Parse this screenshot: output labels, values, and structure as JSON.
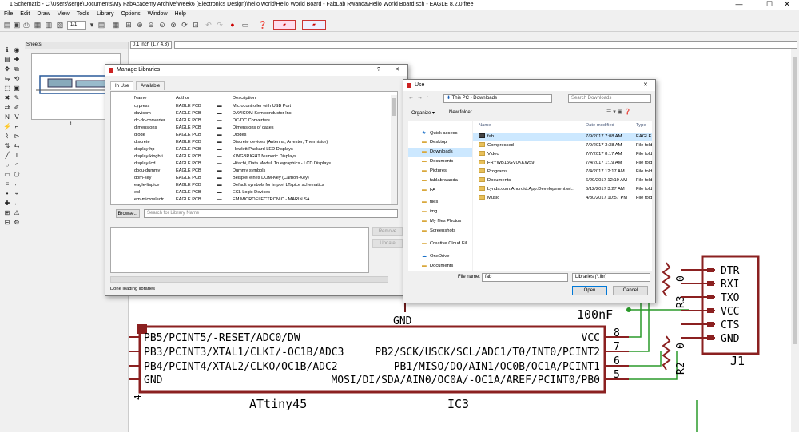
{
  "window": {
    "title": "1 Schematic - C:\\Users\\serge\\Documents\\My FabAcademy Archive\\Week6 (Electronics Design)\\hello world\\Hello World Board - FabLab Rwanda\\Hello World Board.sch - EAGLE 8.2.0 free",
    "min": "—",
    "max": "☐",
    "close": "✕"
  },
  "menu": [
    "File",
    "Edit",
    "Draw",
    "View",
    "Tools",
    "Library",
    "Options",
    "Window",
    "Help"
  ],
  "toolbar": {
    "sheet_select": "1/1"
  },
  "commandbar": {
    "coordinate": "0.1 inch (1.7 4.3)",
    "command_input": ""
  },
  "sheets_panel": {
    "title": "Sheets",
    "page_number": "1"
  },
  "manage_libraries": {
    "title": "Manage Libraries",
    "help": "?",
    "close": "✕",
    "tabs": [
      "In Use",
      "Available"
    ],
    "columns": [
      "Name",
      "Author",
      "Description"
    ],
    "rows": [
      {
        "name": "cypress",
        "author": "EAGLE PCB",
        "desc": "Microcontroller with USB Port"
      },
      {
        "name": "davicom",
        "author": "EAGLE PCB",
        "desc": "DAVICOM Semiconductor Inc."
      },
      {
        "name": "dc-dc-converter",
        "author": "EAGLE PCB",
        "desc": "DC-DC Converters"
      },
      {
        "name": "dimensions",
        "author": "EAGLE PCB",
        "desc": "Dimensions of cases"
      },
      {
        "name": "diode",
        "author": "EAGLE PCB",
        "desc": "Diodes"
      },
      {
        "name": "discrete",
        "author": "EAGLE PCB",
        "desc": "Discrete devices (Antenna, Arrester, Thermistor)"
      },
      {
        "name": "display-hp",
        "author": "EAGLE PCB",
        "desc": "Hewlett Packard LED Displays"
      },
      {
        "name": "display-kingbri...",
        "author": "EAGLE PCB",
        "desc": "KINGBRIGHT Numeric Displays"
      },
      {
        "name": "display-lcd",
        "author": "EAGLE PCB",
        "desc": "Hitachi, Data Modul, Truegraphics - LCD Displays"
      },
      {
        "name": "docu-dummy",
        "author": "EAGLE PCB",
        "desc": "Dummy symbols"
      },
      {
        "name": "dom-key",
        "author": "EAGLE PCB",
        "desc": "Beispiel eines DOM-Key (Carbon-Key)"
      },
      {
        "name": "eagle-ltspice",
        "author": "EAGLE PCB",
        "desc": "Default symbols for import LTspice schematics"
      },
      {
        "name": "ecl",
        "author": "EAGLE PCB",
        "desc": "ECL Logic Devices"
      },
      {
        "name": "em-microelectr...",
        "author": "EAGLE PCB",
        "desc": "EM MICROELECTRONIC - MARIN SA"
      }
    ],
    "browse_label": "Browse...",
    "search_placeholder": "Search for Library Name",
    "remove_label": "Remove",
    "update_label": "Update",
    "status": "Done loading libraries"
  },
  "use_dialog": {
    "title": "Use",
    "close": "✕",
    "path": [
      "This PC",
      "Downloads"
    ],
    "search_placeholder": "Search Downloads",
    "organize_label": "Organize ▾",
    "new_folder_label": "New folder",
    "nav": [
      "Quick access",
      "Desktop",
      "Downloads",
      "Documents",
      "Pictures",
      "fablabrwanda",
      "FA",
      "files",
      "img",
      "My files Photos",
      "Screenshots",
      "Creative Cloud Fil",
      "OneDrive",
      "Documents"
    ],
    "columns": [
      "Name",
      "Date modified",
      "Type"
    ],
    "files": [
      {
        "name": "fab",
        "date": "7/9/2017 7:08 AM",
        "type": "EAGLE libr"
      },
      {
        "name": "Compressed",
        "date": "7/9/2017 3:38 AM",
        "type": "File folder"
      },
      {
        "name": "Video",
        "date": "7/7/2017 8:17 AM",
        "type": "File folder"
      },
      {
        "name": "FRYWB15GV0KKW59",
        "date": "7/4/2017 1:19 AM",
        "type": "File folder"
      },
      {
        "name": "Programs",
        "date": "7/4/2017 12:17 AM",
        "type": "File folder"
      },
      {
        "name": "Documents",
        "date": "6/29/2017 12:19 AM",
        "type": "File folder"
      },
      {
        "name": "Lynda.com.Android.App.Development.wi...",
        "date": "6/12/2017 3:27 AM",
        "type": "File folder"
      },
      {
        "name": "Music",
        "date": "4/30/2017 10:57 PM",
        "type": "File folder"
      }
    ],
    "filename_label": "File name:",
    "filename_value": "fab",
    "filetype_value": "Libraries (*.lbr)",
    "open_label": "Open",
    "cancel_label": "Cancel"
  },
  "schematic": {
    "gnd_label": "GND",
    "cap_value": "100nF",
    "ic_pins_left": [
      "PB5/PCINT5/-RESET/ADC0/DW",
      "PB3/PCINT3/XTAL1/CLKI/-OC1B/ADC3",
      "PB4/PCINT4/XTAL2/CLKO/OC1B/ADC2",
      "GND"
    ],
    "ic_pins_right": [
      "VCC",
      "PB2/SCK/USCK/SCL/ADC1/T0/INT0/PCINT2",
      "PB1/MISO/DO/AIN1/OC0B/OC1A/PCINT1",
      "MOSI/DI/SDA/AIN0/OC0A/-OC1A/AREF/PCINT0/PB0"
    ],
    "ic_pin_numbers": [
      "8",
      "7",
      "6",
      "5"
    ],
    "ic_value": "ATtiny45",
    "ic_name": "IC3",
    "r3_label": "R3",
    "r3_value": "0",
    "r2_label": "R2",
    "r2_value": "0",
    "connector_pins": [
      "DTR",
      "RXI",
      "TXO",
      "VCC",
      "CTS",
      "GND"
    ],
    "connector_name": "J1",
    "left_pin_number": "4"
  }
}
